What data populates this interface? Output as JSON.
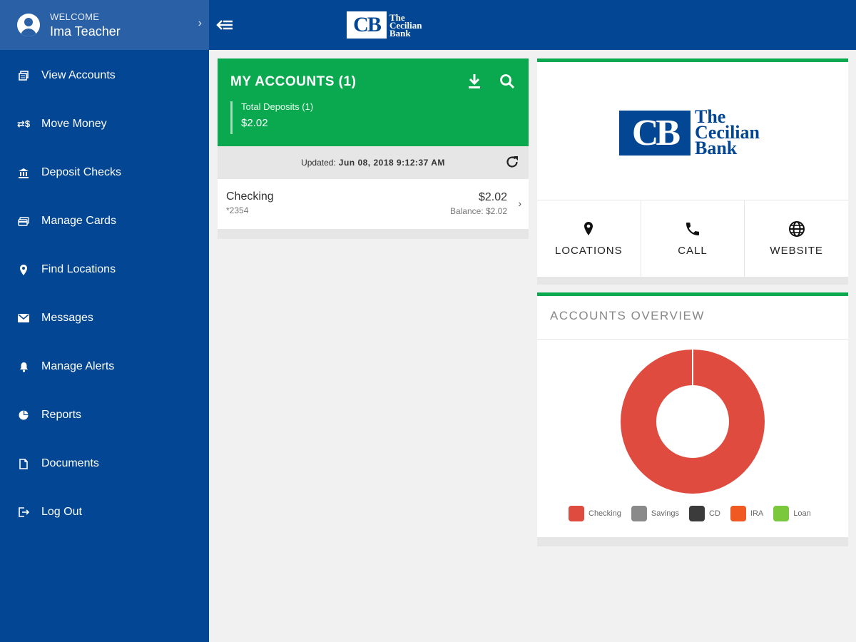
{
  "user": {
    "welcome_label": "WELCOME",
    "name": "Ima Teacher"
  },
  "nav": [
    {
      "label": "View Accounts",
      "icon": "accounts-icon"
    },
    {
      "label": "Move Money",
      "icon": "transfer-icon"
    },
    {
      "label": "Deposit Checks",
      "icon": "bank-icon"
    },
    {
      "label": "Manage Cards",
      "icon": "card-icon"
    },
    {
      "label": "Find Locations",
      "icon": "location-icon"
    },
    {
      "label": "Messages",
      "icon": "mail-icon"
    },
    {
      "label": "Manage Alerts",
      "icon": "bell-icon"
    },
    {
      "label": "Reports",
      "icon": "pie-icon"
    },
    {
      "label": "Documents",
      "icon": "document-icon"
    },
    {
      "label": "Log Out",
      "icon": "logout-icon"
    }
  ],
  "brand": {
    "short": "CB",
    "line1": "The",
    "line2": "Cecilian",
    "line3": "Bank"
  },
  "accounts": {
    "title": "MY ACCOUNTS (1)",
    "total_label": "Total Deposits (1)",
    "total_value": "$2.02",
    "updated_label": "Updated:",
    "updated_value": "Jun 08, 2018 9:12:37 AM",
    "rows": [
      {
        "name": "Checking",
        "number": "*2354",
        "amount": "$2.02",
        "balance": "Balance: $2.02"
      }
    ]
  },
  "quick_links": [
    {
      "label": "LOCATIONS",
      "icon": "pin-icon"
    },
    {
      "label": "CALL",
      "icon": "phone-icon"
    },
    {
      "label": "WEBSITE",
      "icon": "globe-icon"
    }
  ],
  "overview": {
    "title": "ACCOUNTS OVERVIEW",
    "legend": [
      {
        "label": "Checking",
        "color": "#e04b3f"
      },
      {
        "label": "Savings",
        "color": "#8a8a8a"
      },
      {
        "label": "CD",
        "color": "#3b3b3b"
      },
      {
        "label": "IRA",
        "color": "#f05a22"
      },
      {
        "label": "Loan",
        "color": "#7bc83c"
      }
    ],
    "chart_values": [
      2.02,
      0,
      0,
      0,
      0
    ]
  },
  "colors": {
    "primary": "#034694",
    "accent_green": "#0aa84f",
    "checking_red": "#e04b3f"
  }
}
